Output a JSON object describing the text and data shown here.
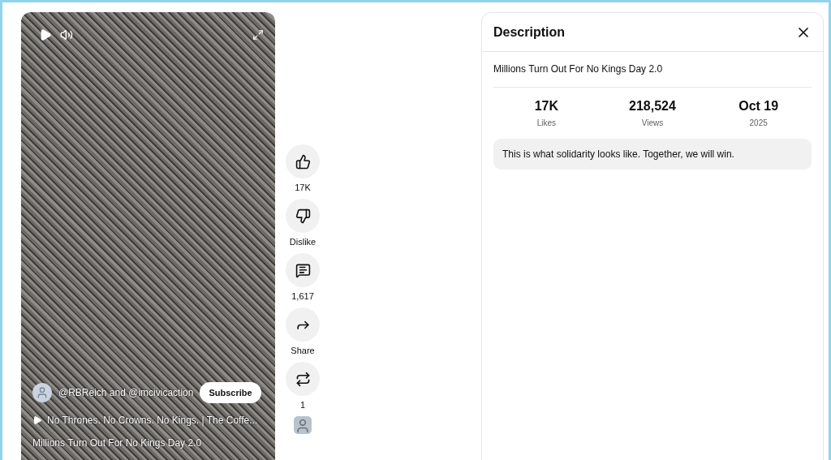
{
  "video": {
    "channel": "@RBReich and @imcivicaction",
    "subscribe": "Subscribe",
    "sound": "No Thrones. No Crowns. No Kings. | The Coffe...",
    "title": "Millions Turn Out For No Kings Day 2.0"
  },
  "actions": [
    {
      "kind": "like",
      "label": "17K"
    },
    {
      "kind": "dislike",
      "label": "Dislike"
    },
    {
      "kind": "comment",
      "label": "1,617"
    },
    {
      "kind": "share",
      "label": "Share"
    },
    {
      "kind": "remix",
      "label": "1"
    }
  ],
  "description": {
    "heading": "Description",
    "title": "Millions Turn Out For No Kings Day 2.0",
    "stats": [
      {
        "value": "17K",
        "label": "Likes"
      },
      {
        "value": "218,524",
        "label": "Views"
      },
      {
        "value": "Oct 19",
        "label": "2025"
      }
    ],
    "body": "This is what solidarity looks like. Together, we will win."
  }
}
